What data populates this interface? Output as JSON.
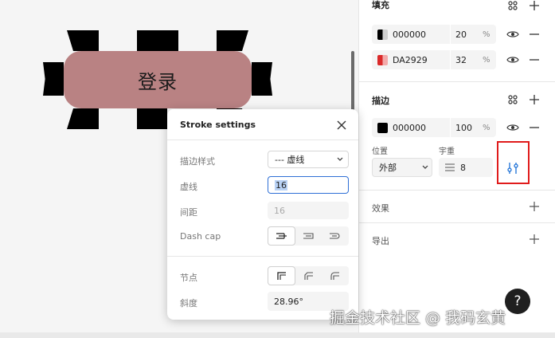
{
  "canvas": {
    "element_text": "登录",
    "element_fill": "#b98283"
  },
  "panel": {
    "fill": {
      "title": "填充",
      "rows": [
        {
          "hex": "000000",
          "opacity": "20",
          "unit": "%",
          "swatch_color": "#000000"
        },
        {
          "hex": "DA2929",
          "opacity": "32",
          "unit": "%",
          "swatch_color": "#DA2929"
        }
      ]
    },
    "stroke": {
      "title": "描边",
      "row": {
        "hex": "000000",
        "opacity": "100",
        "unit": "%",
        "swatch_color": "#000000"
      },
      "position_label": "位置",
      "position_value": "外部",
      "weight_label": "宇重",
      "weight_value": "8"
    },
    "effects": {
      "title": "效果"
    },
    "export": {
      "title": "导出"
    }
  },
  "dialog": {
    "title": "Stroke settings",
    "style_label": "描边样式",
    "style_value": "--- 虚线",
    "dash_label": "虚线",
    "dash_value": "16",
    "gap_label": "间距",
    "gap_placeholder": "16",
    "dashcap_label": "Dash cap",
    "joint_label": "节点",
    "miter_label": "斜度",
    "miter_value": "28.96°"
  },
  "help": {
    "label": "?"
  },
  "watermark": "掘金技术社区 @ 我码玄黄",
  "colors": {
    "highlight": "#e01b1b",
    "accent": "#1a6fd6"
  }
}
